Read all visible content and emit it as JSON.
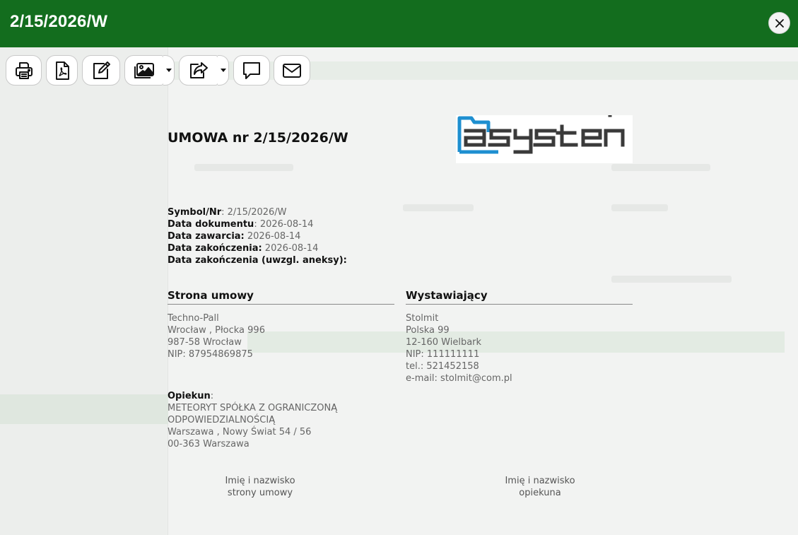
{
  "window": {
    "title": "2/15/2026/W"
  },
  "toolbar": {
    "buttons": [
      {
        "icon": "print-icon"
      },
      {
        "icon": "pdf-icon"
      },
      {
        "icon": "edit-icon"
      },
      {
        "icon": "images-icon"
      },
      {
        "icon": "share-icon"
      },
      {
        "icon": "comment-icon"
      },
      {
        "icon": "mail-icon"
      }
    ]
  },
  "document": {
    "title": "UMOWA nr 2/15/2026/W",
    "logo_text": "asystent",
    "meta": [
      {
        "label": "Symbol/Nr",
        "sep": ":",
        "value": " 2/15/2026/W"
      },
      {
        "label": "Data dokumentu",
        "sep": ":",
        "value": " 2026-08-14"
      },
      {
        "label": "Data zawarcia:",
        "sep": "",
        "value": " 2026-08-14"
      },
      {
        "label": "Data zakończenia:",
        "sep": "",
        "value": " 2026-08-14"
      },
      {
        "label": "Data zakończenia (uwzgl. aneksy):",
        "sep": "",
        "value": ""
      }
    ],
    "party": {
      "heading": "Strona umowy",
      "lines": [
        "Techno-Pall",
        "Wrocław , Płocka 996",
        "987-58 Wrocław",
        "NIP: 87954869875"
      ]
    },
    "issuer": {
      "heading": "Wystawiający",
      "lines": [
        "Stolmit",
        "Polska 99",
        "12-160 Wielbark",
        "NIP: 111111111",
        "tel.: 521452158",
        "e-mail: stolmit@com.pl"
      ]
    },
    "guardian": {
      "label": "Opiekun",
      "colon": ":",
      "lines": [
        "METEORYT SPÓŁKA Z OGRANICZONĄ",
        "ODPOWIEDZIALNOŚCIĄ",
        "Warszawa , Nowy Świat 54 / 56",
        "00-363 Warszawa"
      ]
    },
    "signatures": {
      "left": [
        "Imię i nazwisko",
        "strony umowy"
      ],
      "right": [
        "Imię i nazwisko",
        "opiekuna"
      ]
    }
  }
}
